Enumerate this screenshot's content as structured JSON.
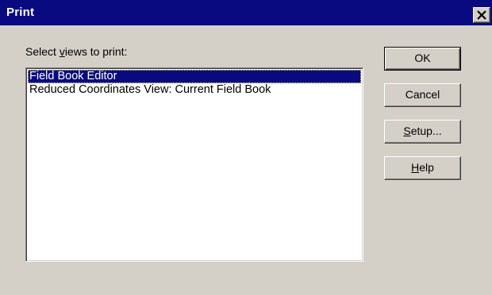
{
  "window": {
    "title": "Print"
  },
  "prompt": {
    "before": "Select ",
    "mnemonic": "v",
    "after": "iews to print:"
  },
  "views_list": {
    "items": [
      {
        "label": "Field Book Editor",
        "selected": true
      },
      {
        "label": "Reduced Coordinates View: Current Field Book",
        "selected": false
      }
    ]
  },
  "buttons": {
    "ok": {
      "label": "OK"
    },
    "cancel": {
      "label": "Cancel"
    },
    "setup": {
      "mnemonic": "S",
      "rest": "etup..."
    },
    "help": {
      "mnemonic": "H",
      "rest": "elp"
    }
  },
  "icons": {
    "close": "close-icon"
  },
  "colors": {
    "title_bar": "#0a0a80",
    "selection": "#0a0a80",
    "face": "#d4d0c8"
  }
}
